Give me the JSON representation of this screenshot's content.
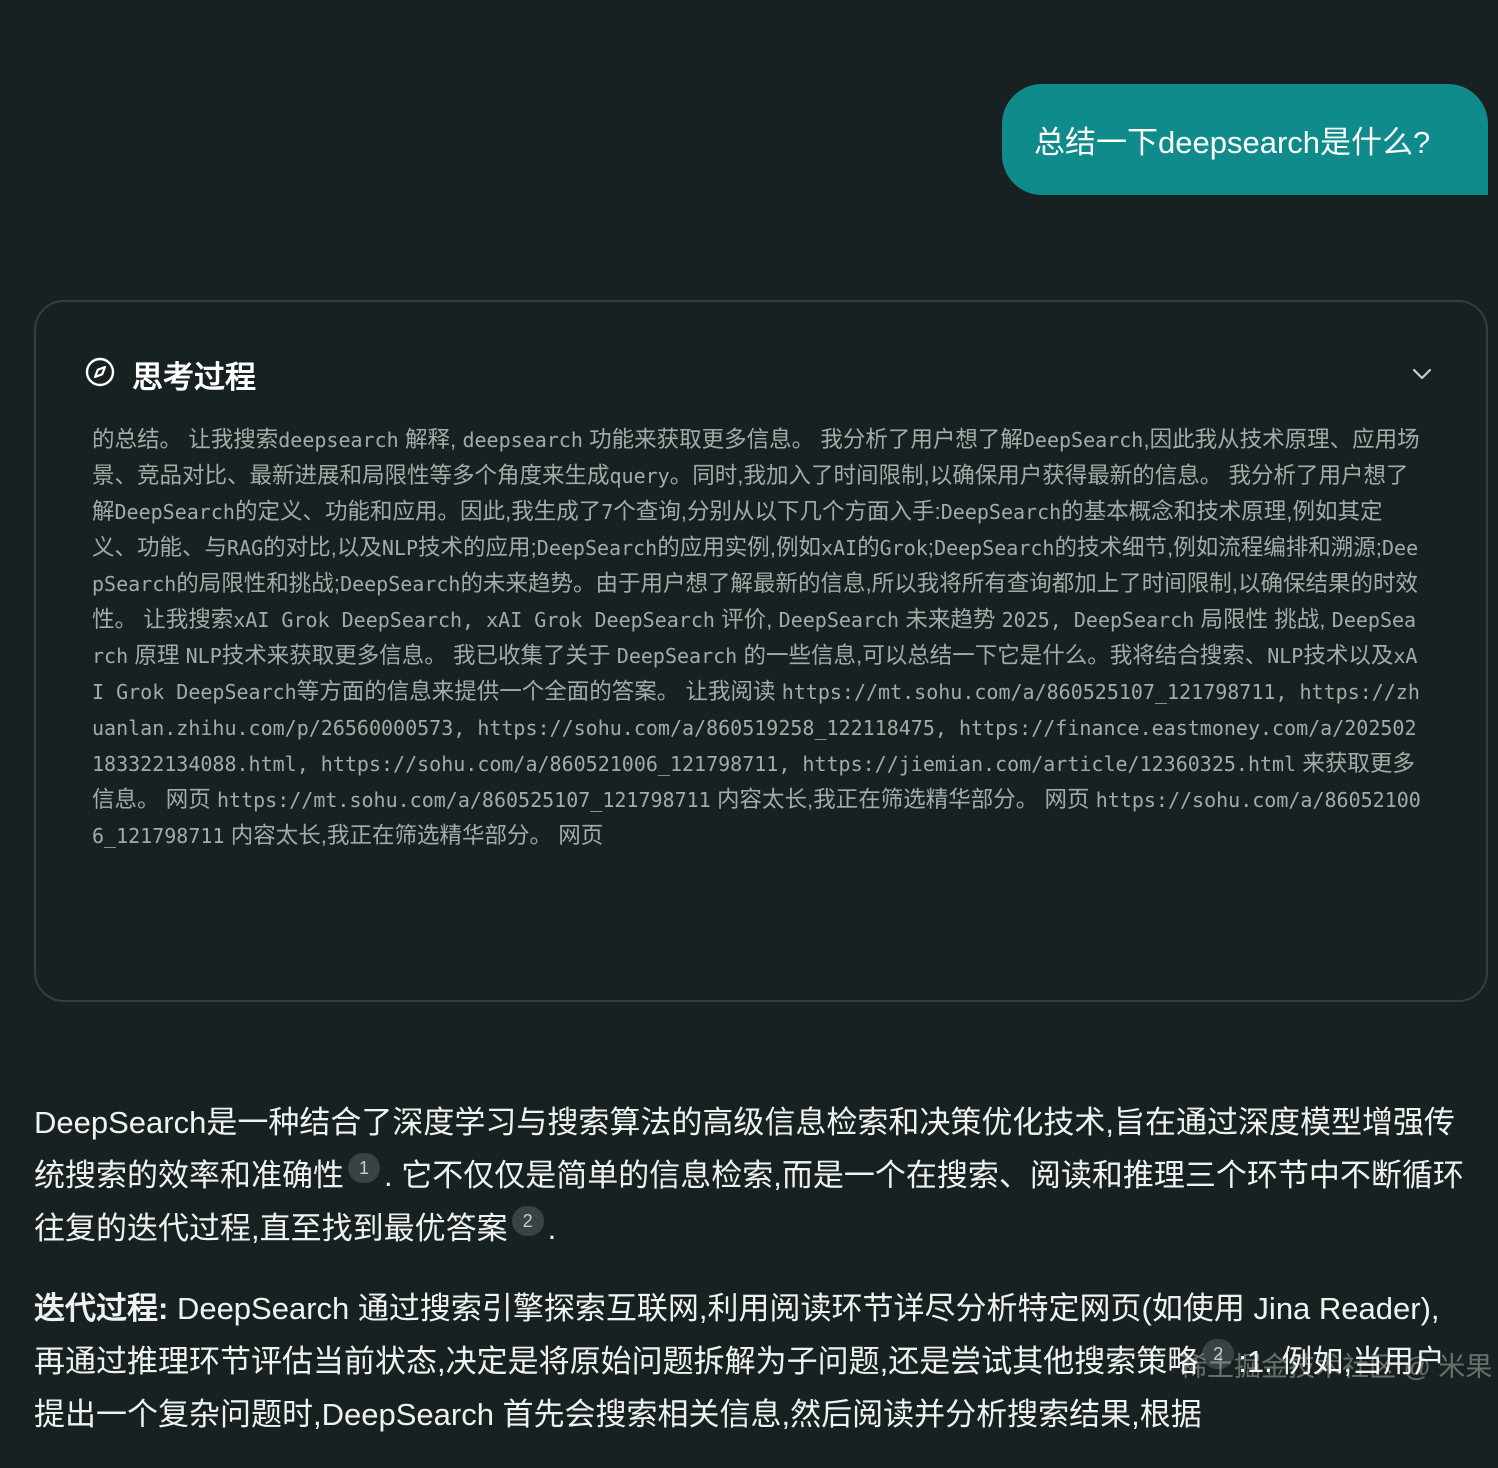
{
  "user_message": "总结一下deepsearch是什么?",
  "thinking": {
    "title": "思考过程",
    "icon": "compass-icon",
    "toggle_icon": "chevron-down-icon",
    "segments": [
      {
        "t": "的总结。 让我搜索"
      },
      {
        "t": "deepsearch",
        "m": true
      },
      {
        "t": " 解释, "
      },
      {
        "t": "deepsearch",
        "m": true
      },
      {
        "t": " 功能来获取更多信息。 我分析了用户想了解"
      },
      {
        "t": "DeepSearch",
        "m": true
      },
      {
        "t": ",因此我从技术原理、应用场景、竞品对比、最新进展和局限性等多个角度来生成"
      },
      {
        "t": "query",
        "m": true
      },
      {
        "t": "。同时,我加入了时间限制,以确保用户获得最新的信息。 我分析了用户想了解"
      },
      {
        "t": "DeepSearch",
        "m": true
      },
      {
        "t": "的定义、功能和应用。因此,我生成了"
      },
      {
        "t": "7",
        "m": true
      },
      {
        "t": "个查询,分别从以下几个方面入手:"
      },
      {
        "t": "DeepSearch",
        "m": true
      },
      {
        "t": "的基本概念和技术原理,例如其定义、功能、与"
      },
      {
        "t": "RAG",
        "m": true
      },
      {
        "t": "的对比,以及"
      },
      {
        "t": "NLP",
        "m": true
      },
      {
        "t": "技术的应用;"
      },
      {
        "t": "DeepSearch",
        "m": true
      },
      {
        "t": "的应用实例,例如"
      },
      {
        "t": "xAI",
        "m": true
      },
      {
        "t": "的"
      },
      {
        "t": "Grok",
        "m": true
      },
      {
        "t": ";"
      },
      {
        "t": "DeepSearch",
        "m": true
      },
      {
        "t": "的技术细节,例如流程编排和溯源;"
      },
      {
        "t": "DeepSearch",
        "m": true
      },
      {
        "t": "的局限性和挑战;"
      },
      {
        "t": "DeepSearch",
        "m": true
      },
      {
        "t": "的未来趋势。由于用户想了解最新的信息,所以我将所有查询都加上了时间限制,以确保结果的时效性。 让我搜索"
      },
      {
        "t": "xAI Grok DeepSearch, xAI Grok DeepSearch",
        "m": true
      },
      {
        "t": " 评价, "
      },
      {
        "t": "DeepSearch",
        "m": true
      },
      {
        "t": " 未来趋势 "
      },
      {
        "t": "2025, DeepSearch",
        "m": true
      },
      {
        "t": " 局限性 挑战, "
      },
      {
        "t": "DeepSearch",
        "m": true
      },
      {
        "t": " 原理 "
      },
      {
        "t": "NLP",
        "m": true
      },
      {
        "t": "技术来获取更多信息。 我已收集了关于 "
      },
      {
        "t": "DeepSearch",
        "m": true
      },
      {
        "t": " 的一些信息,可以总结一下它是什么。我将结合搜索、"
      },
      {
        "t": "NLP",
        "m": true
      },
      {
        "t": "技术以及"
      },
      {
        "t": "xAI Grok DeepSearch",
        "m": true
      },
      {
        "t": "等方面的信息来提供一个全面的答案。 让我阅读 "
      },
      {
        "t": "https://mt.sohu.com/a/860525107_121798711, https://zhuanlan.zhihu.com/p/26560000573, https://sohu.com/a/860519258_122118475, https://finance.eastmoney.com/a/202502183322134088.html, https://sohu.com/a/860521006_121798711, https://jiemian.com/article/12360325.html",
        "m": true
      },
      {
        "t": " 来获取更多信息。 网页 "
      },
      {
        "t": "https://mt.sohu.com/a/860525107_121798711",
        "m": true
      },
      {
        "t": " 内容太长,我正在筛选精华部分。 网页 "
      },
      {
        "t": "https://sohu.com/a/860521006_121798711",
        "m": true
      },
      {
        "t": " 内容太长,我正在筛选精华部分。 网页"
      }
    ]
  },
  "answer": {
    "p1": {
      "a": "DeepSearch是一种结合了深度学习与搜索算法的高级信息检索和决策优化技术,旨在通过深度模型增强传统搜索的效率和准确性",
      "cite1": "1",
      "b": ". 它不仅仅是简单的信息检索,而是一个在搜索、阅读和推理三个环节中不断循环往复的迭代过程,直至找到最优答案",
      "cite2": "2",
      "c": "."
    },
    "p2": {
      "label": "迭代过程:",
      "text": " DeepSearch 通过搜索引擎探索互联网,利用阅读环节详尽分析特定网页(如使用 Jina Reader),再通过推理环节评估当前状态,决定是将原始问题拆解为子问题,还是尝试其他搜索策略",
      "cite": "2",
      "cite_b": "1",
      "end": ".",
      "next": "例如,当用户提出一个复杂问题时,DeepSearch 首先会搜索相关信息,然后阅读并分析搜索结果,根据"
    }
  },
  "watermark": "稀土掘金技术社区 @ 米果"
}
